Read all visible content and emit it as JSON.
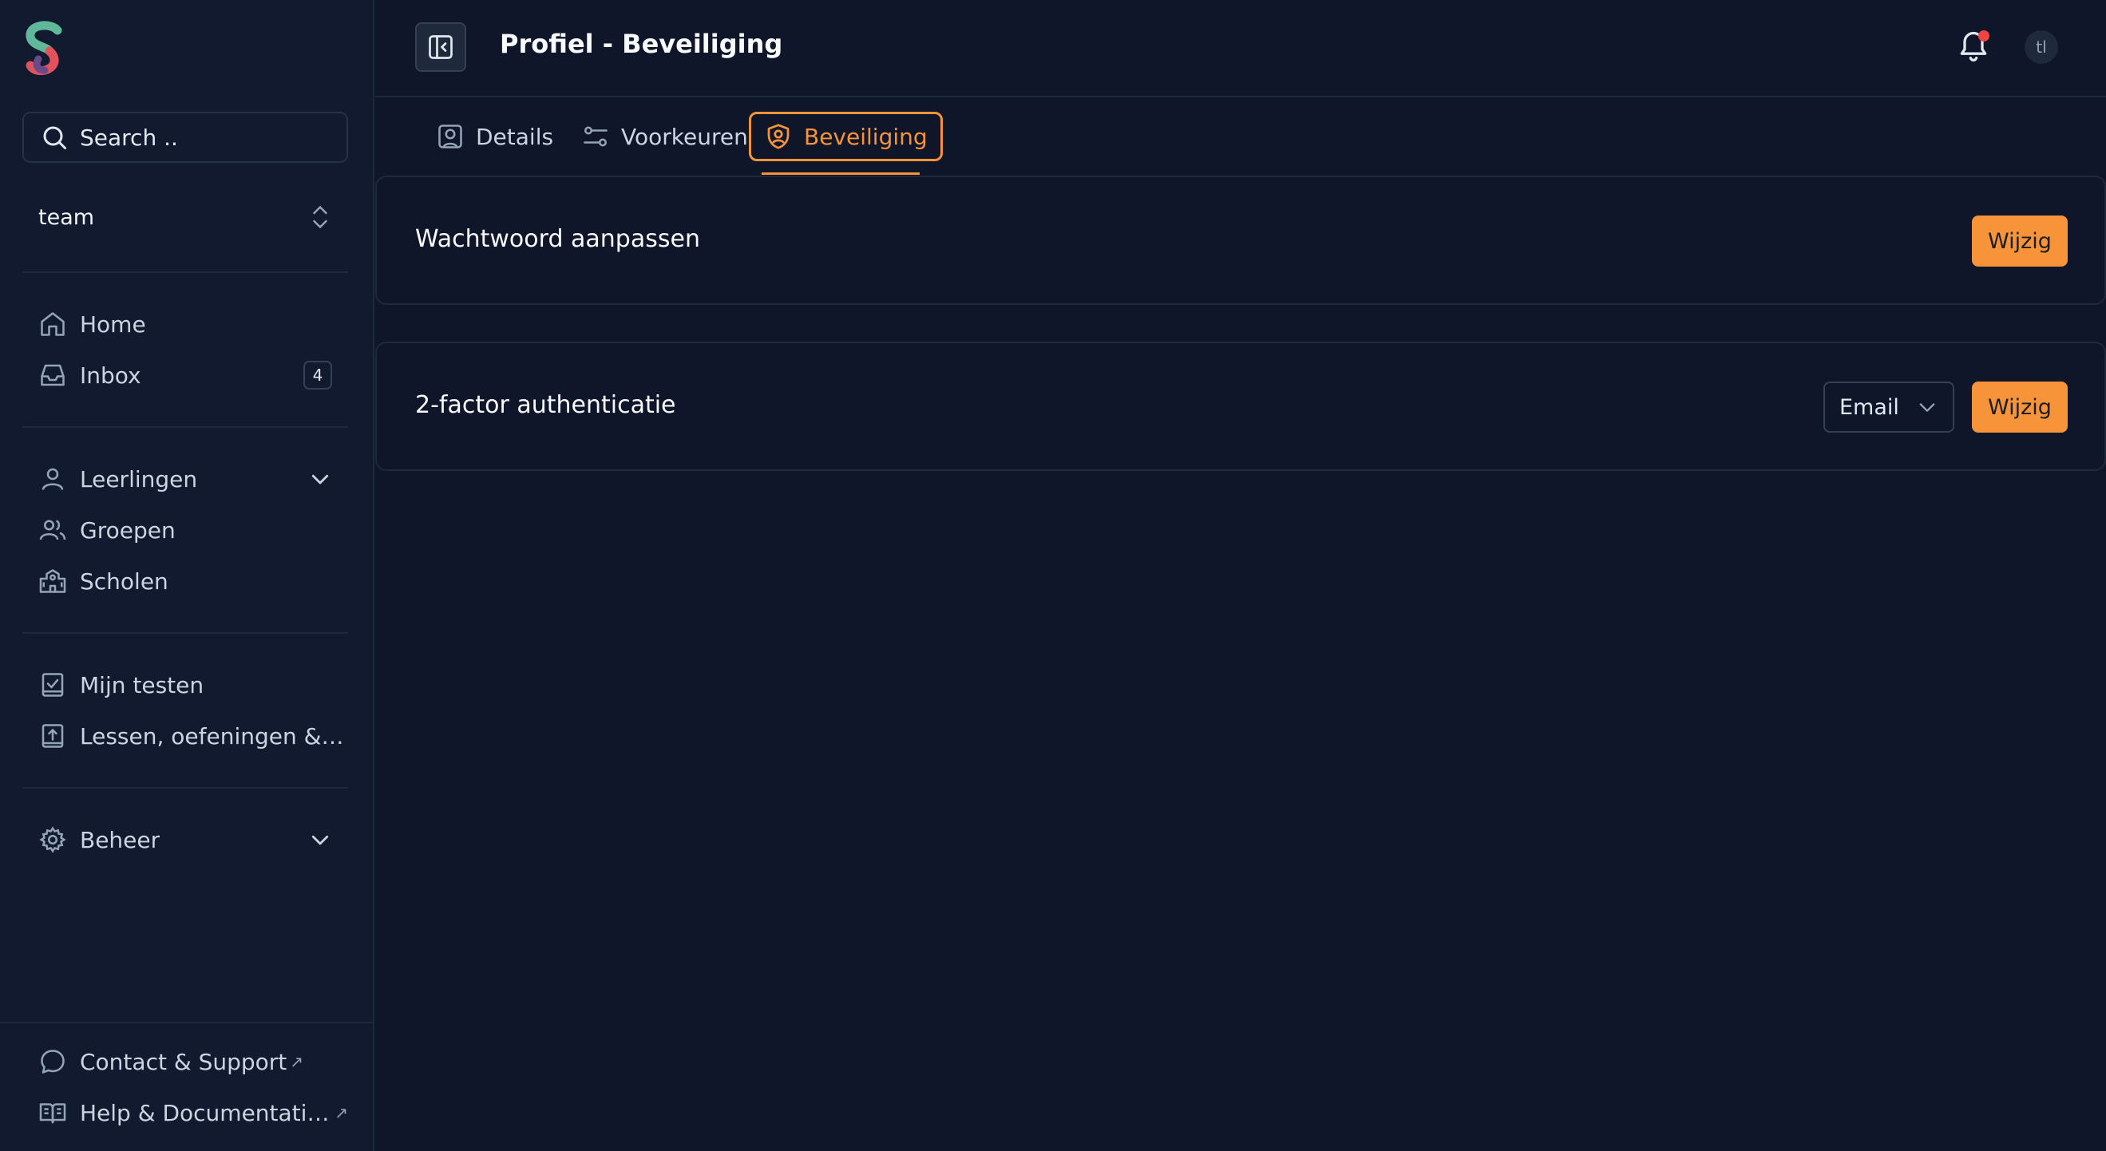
{
  "sidebar": {
    "search": {
      "placeholder": "Search .."
    },
    "team": "team",
    "nav_primary": [
      {
        "label": "Home",
        "icon": "home-icon"
      },
      {
        "label": "Inbox",
        "icon": "inbox-icon",
        "badge": "4"
      }
    ],
    "nav_people": [
      {
        "label": "Leerlingen",
        "icon": "user-icon"
      },
      {
        "label": "Groepen",
        "icon": "users-icon"
      },
      {
        "label": "Scholen",
        "icon": "school-icon"
      }
    ],
    "nav_tests": [
      {
        "label": "Mijn testen",
        "icon": "clipboard-check-icon"
      },
      {
        "label": "Lessen, oefeningen & t...",
        "icon": "book-upload-icon"
      }
    ],
    "nav_admin": [
      {
        "label": "Beheer",
        "icon": "gear-icon"
      }
    ],
    "footer": [
      {
        "label": "Contact & Support",
        "icon": "chat-icon"
      },
      {
        "label": "Help & Documentation",
        "icon": "book-open-icon"
      }
    ]
  },
  "header": {
    "title": "Profiel - Beveiliging",
    "avatar_initials": "tl"
  },
  "tabs": [
    {
      "label": "Details",
      "icon": "user-square-icon",
      "active": false
    },
    {
      "label": "Voorkeuren",
      "icon": "sliders-icon",
      "active": false
    },
    {
      "label": "Beveiliging",
      "icon": "shield-user-icon",
      "active": true
    }
  ],
  "security": {
    "password": {
      "title": "Wachtwoord aanpassen",
      "button": "Wijzig"
    },
    "twofactor": {
      "title": "2-factor authenticatie",
      "method": "Email",
      "button": "Wijzig"
    }
  },
  "colors": {
    "accent": "#f7943a",
    "background": "#0f1629",
    "sidebar": "#111a2e",
    "notification": "#ef4444"
  }
}
